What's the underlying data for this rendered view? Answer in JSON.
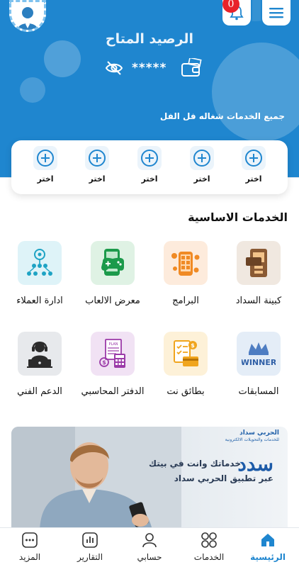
{
  "header": {
    "balance_title": "الرصيد المتاح",
    "balance_masked": "*****",
    "services_status": "جميع الخدمات شغاله فل الفل",
    "notification_count": "0"
  },
  "quick_actions": [
    {
      "label": "اختر"
    },
    {
      "label": "اختر"
    },
    {
      "label": "اختر"
    },
    {
      "label": "اختر"
    },
    {
      "label": "اختر"
    }
  ],
  "basic_services": {
    "title": "الخدمات الاساسية",
    "items": [
      {
        "label": "كبينة السداد",
        "icon": "phone-booth-icon"
      },
      {
        "label": "البرامج",
        "icon": "apps-icon"
      },
      {
        "label": "معرض الالعاب",
        "icon": "gamepad-icon"
      },
      {
        "label": "ادارة العملاء",
        "icon": "customers-network-icon"
      },
      {
        "label": "المسابقات",
        "icon": "winner-crown-icon"
      },
      {
        "label": "بطائق نت",
        "icon": "net-cards-icon"
      },
      {
        "label": "الدفتر المحاسبي",
        "icon": "accounting-book-icon"
      },
      {
        "label": "الدعم الفني",
        "icon": "support-headset-icon"
      }
    ]
  },
  "banner": {
    "brand": "الحربي سداد",
    "brand_sub": "للخدمات والتحويلات الالكترونية",
    "headline": "سدد",
    "line1": "خدماتك وانت في بيتك",
    "line2": "عبر تطبيق الحربي سداد"
  },
  "bottom_nav": [
    {
      "label": "الرئيسية",
      "icon": "home-icon",
      "active": true
    },
    {
      "label": "الخدمات",
      "icon": "grid-icon",
      "active": false
    },
    {
      "label": "حسابي",
      "icon": "user-icon",
      "active": false
    },
    {
      "label": "التقارير",
      "icon": "reports-icon",
      "active": false
    },
    {
      "label": "المزيد",
      "icon": "more-icon",
      "active": false
    }
  ],
  "colors": {
    "primary": "#1f86cf",
    "badge": "#e8222a"
  }
}
